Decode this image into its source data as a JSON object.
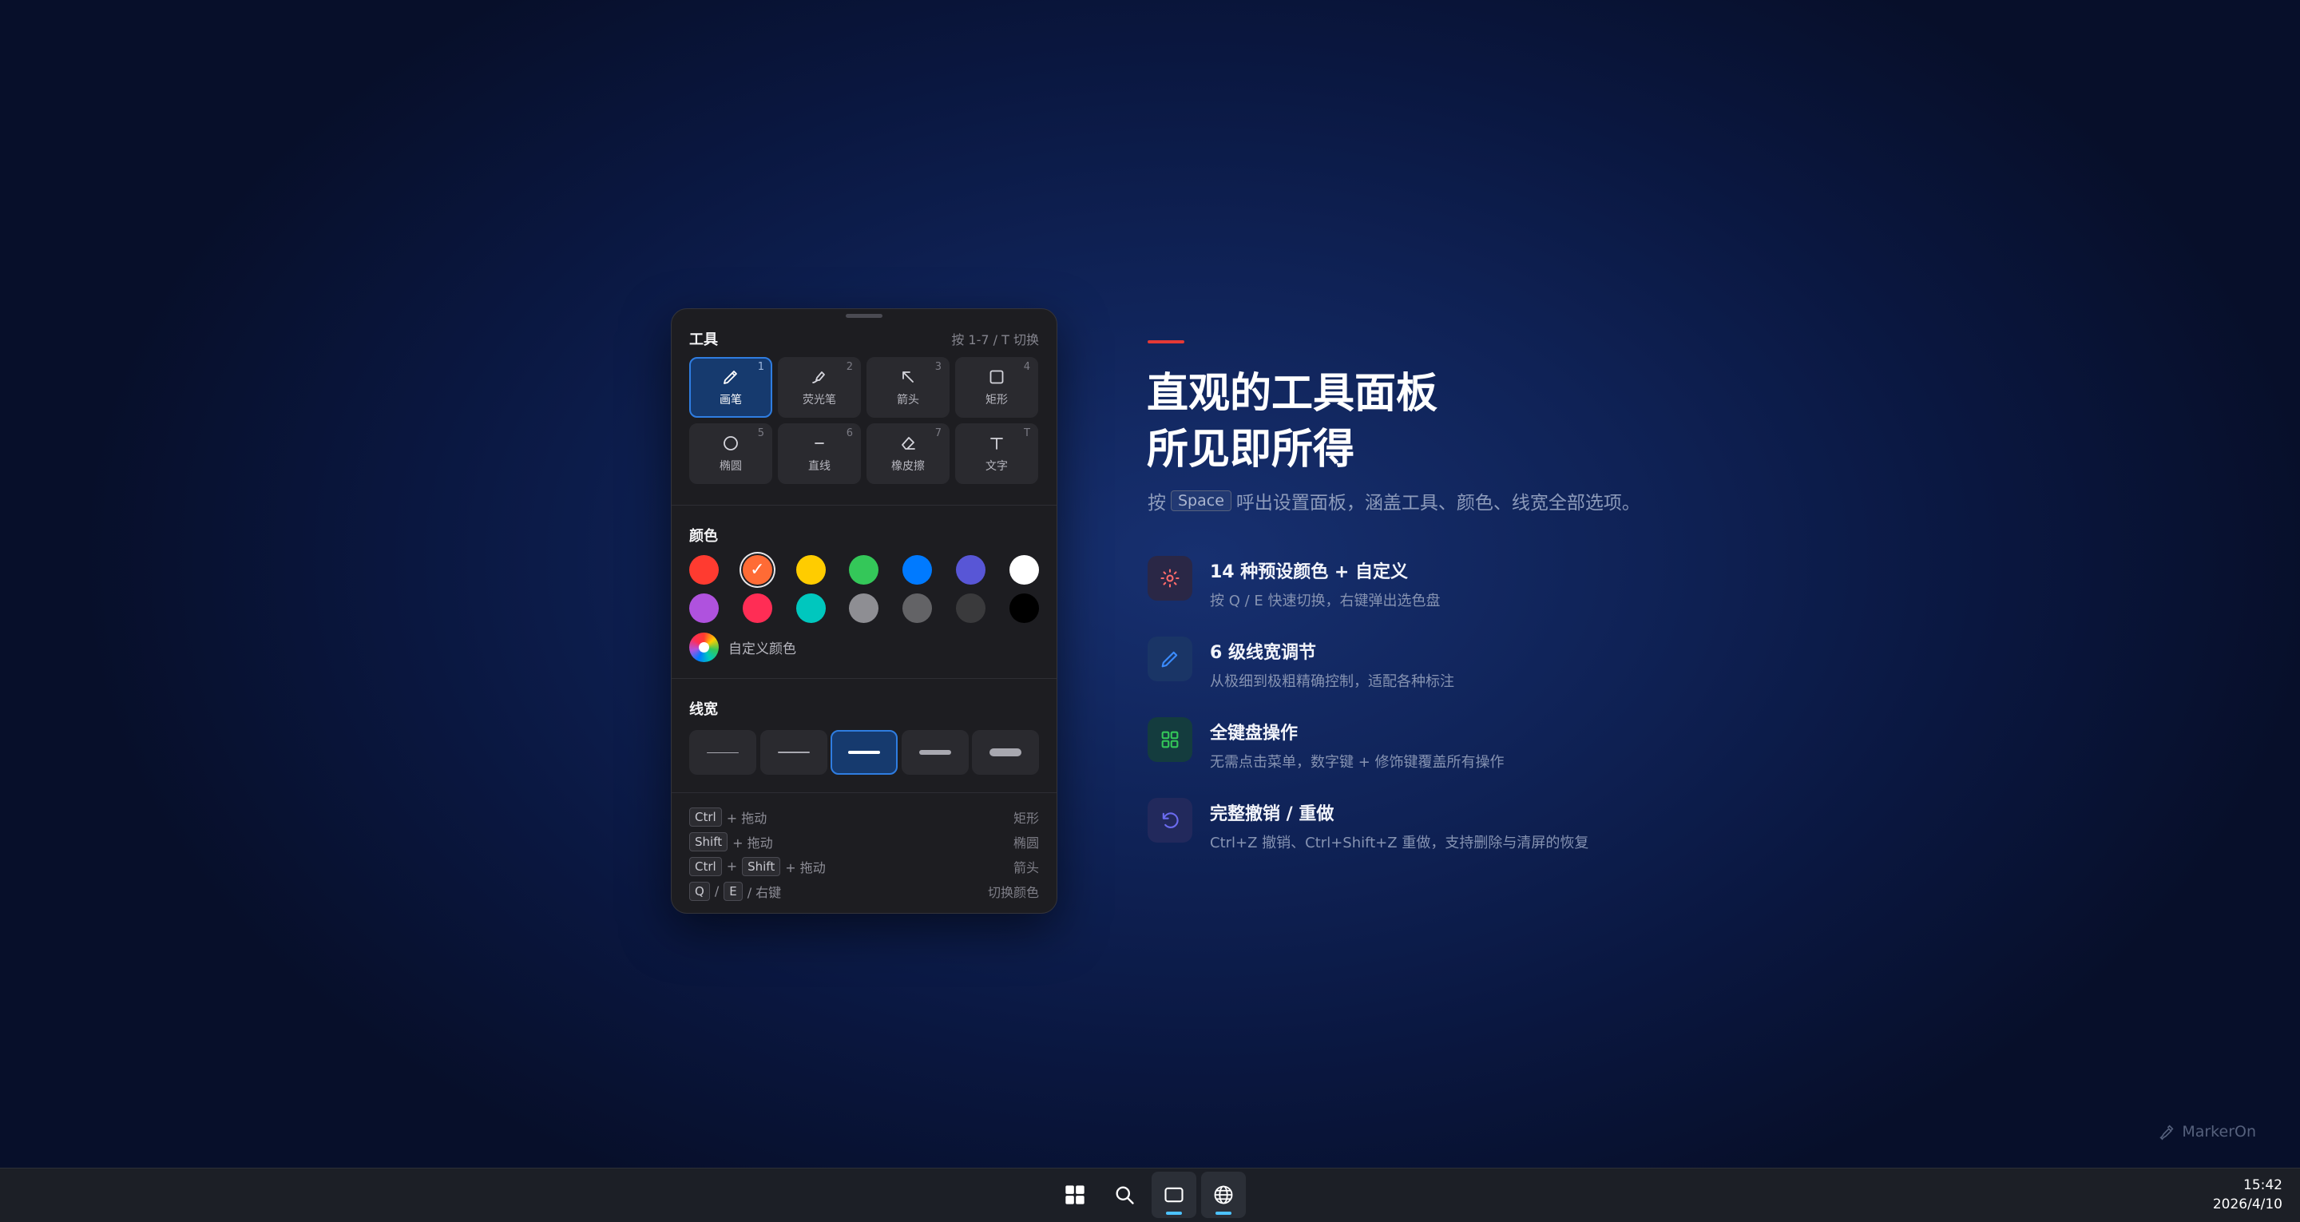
{
  "panel": {
    "tools_title": "工具",
    "tools_hint": "按 1-7 / T 切换",
    "tools": [
      {
        "key": "1",
        "label": "画笔",
        "icon": "pencil-icon",
        "active": true
      },
      {
        "key": "2",
        "label": "荧光笔",
        "icon": "highlighter-icon",
        "active": false
      },
      {
        "key": "3",
        "label": "箭头",
        "icon": "arrow-icon",
        "active": false
      },
      {
        "key": "4",
        "label": "矩形",
        "icon": "rectangle-icon",
        "active": false
      },
      {
        "key": "5",
        "label": "椭圆",
        "icon": "ellipse-icon",
        "active": false
      },
      {
        "key": "6",
        "label": "直线",
        "icon": "line-icon",
        "active": false
      },
      {
        "key": "7",
        "label": "橡皮擦",
        "icon": "eraser-icon",
        "active": false
      },
      {
        "key": "T",
        "label": "文字",
        "icon": "text-icon",
        "active": false
      }
    ],
    "colors_title": "颜色",
    "colors": [
      "#ff3b30",
      "#ff6b35",
      "#ffcc00",
      "#34c759",
      "#007aff",
      "#5856d6",
      "#ffffff",
      "#af52de",
      "#ff2d55",
      "#00c7be",
      "#8e8e93",
      "#636366",
      "#3a3a3c",
      "#000000"
    ],
    "selected_color_index": 1,
    "check_glyph": "✓",
    "custom_color_label": "自定义颜色",
    "width_title": "线宽",
    "widths": [
      1,
      2,
      4,
      6,
      10
    ],
    "selected_width_index": 2,
    "shortcuts": [
      {
        "keys": [
          "Ctrl"
        ],
        "suffix": "+ 拖动",
        "action": "矩形"
      },
      {
        "keys": [
          "Shift"
        ],
        "suffix": "+ 拖动",
        "action": "椭圆"
      },
      {
        "keys": [
          "Ctrl",
          "Shift"
        ],
        "suffix": "+ 拖动",
        "action": "箭头"
      },
      {
        "keys": [
          "Q",
          "E"
        ],
        "suffix": "/ 右键",
        "action": "切换颜色"
      }
    ],
    "key_joiner_plus": "+",
    "key_joiner_slash": "/"
  },
  "hero": {
    "line1": "直观的工具面板",
    "line2": "所见即所得",
    "sub_before": "按",
    "sub_key": "Space",
    "sub_after": "呼出设置面板，涵盖工具、颜色、线宽全部选项。",
    "accent_color": "#e53935"
  },
  "features": [
    {
      "title": "14 种预设颜色 + 自定义",
      "desc": "按 Q / E 快速切换，右键弹出选色盘",
      "icon": "palette-icon",
      "color": "#ff6b6b",
      "bg": "#2a2746"
    },
    {
      "title": "6 级线宽调节",
      "desc": "从极细到极粗精确控制，适配各种标注",
      "icon": "pen-icon",
      "color": "#3b8cff",
      "bg": "#1a3566"
    },
    {
      "title": "全键盘操作",
      "desc": "无需点击菜单，数字键 + 修饰键覆盖所有操作",
      "icon": "grid-icon",
      "color": "#34c759",
      "bg": "#143c3e"
    },
    {
      "title": "完整撤销 / 重做",
      "desc": "Ctrl+Z 撤销、Ctrl+Shift+Z 重做，支持删除与清屏的恢复",
      "icon": "undo-icon",
      "color": "#6b6bf0",
      "bg": "#22295c"
    }
  ],
  "brand": {
    "name": "MarkerOn"
  },
  "taskbar": {
    "time": "15:42",
    "date": "2026/4/10",
    "items": [
      "start-icon",
      "search-icon",
      "window-icon",
      "globe-icon"
    ]
  }
}
